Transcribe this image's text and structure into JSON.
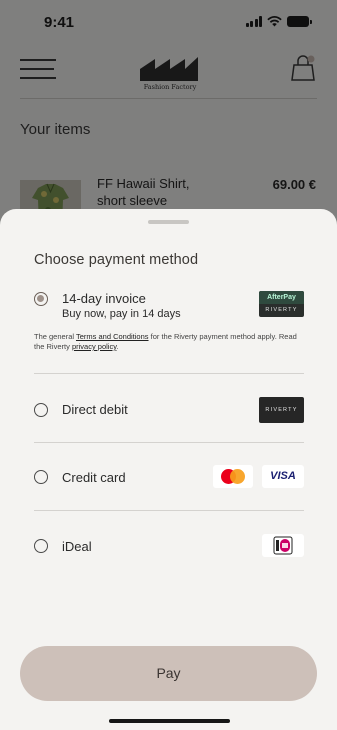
{
  "status_bar": {
    "time": "9:41"
  },
  "header": {
    "logo_text": "Fashion Factory"
  },
  "cart": {
    "heading": "Your items",
    "items": [
      {
        "name": "FF Hawaii Shirt, short sleeve",
        "price": "69.00 €"
      }
    ]
  },
  "sheet": {
    "title": "Choose payment method",
    "options": [
      {
        "label": "14-day invoice",
        "sublabel": "Buy now, pay in 14 days",
        "selected": true,
        "logo_top": "AfterPay",
        "logo_bottom": "RIVERTY",
        "fine_print": {
          "pre": "The general ",
          "link1": "Terms and Conditions",
          "mid": " for the Riverty payment method apply. Read the Riverty ",
          "link2": "privacy policy",
          "post": "."
        }
      },
      {
        "label": "Direct debit",
        "selected": false,
        "logo_text": "RIVERTY"
      },
      {
        "label": "Credit card",
        "selected": false,
        "visa_text": "VISA"
      },
      {
        "label": "iDeal",
        "selected": false
      }
    ],
    "pay_label": "Pay"
  },
  "colors": {
    "accent_button": "#cdc0b9",
    "sheet_bg": "#f4f3f1"
  },
  "icons": [
    "menu-icon",
    "shopping-bag-icon",
    "mastercard-icon",
    "visa-icon",
    "ideal-icon"
  ]
}
